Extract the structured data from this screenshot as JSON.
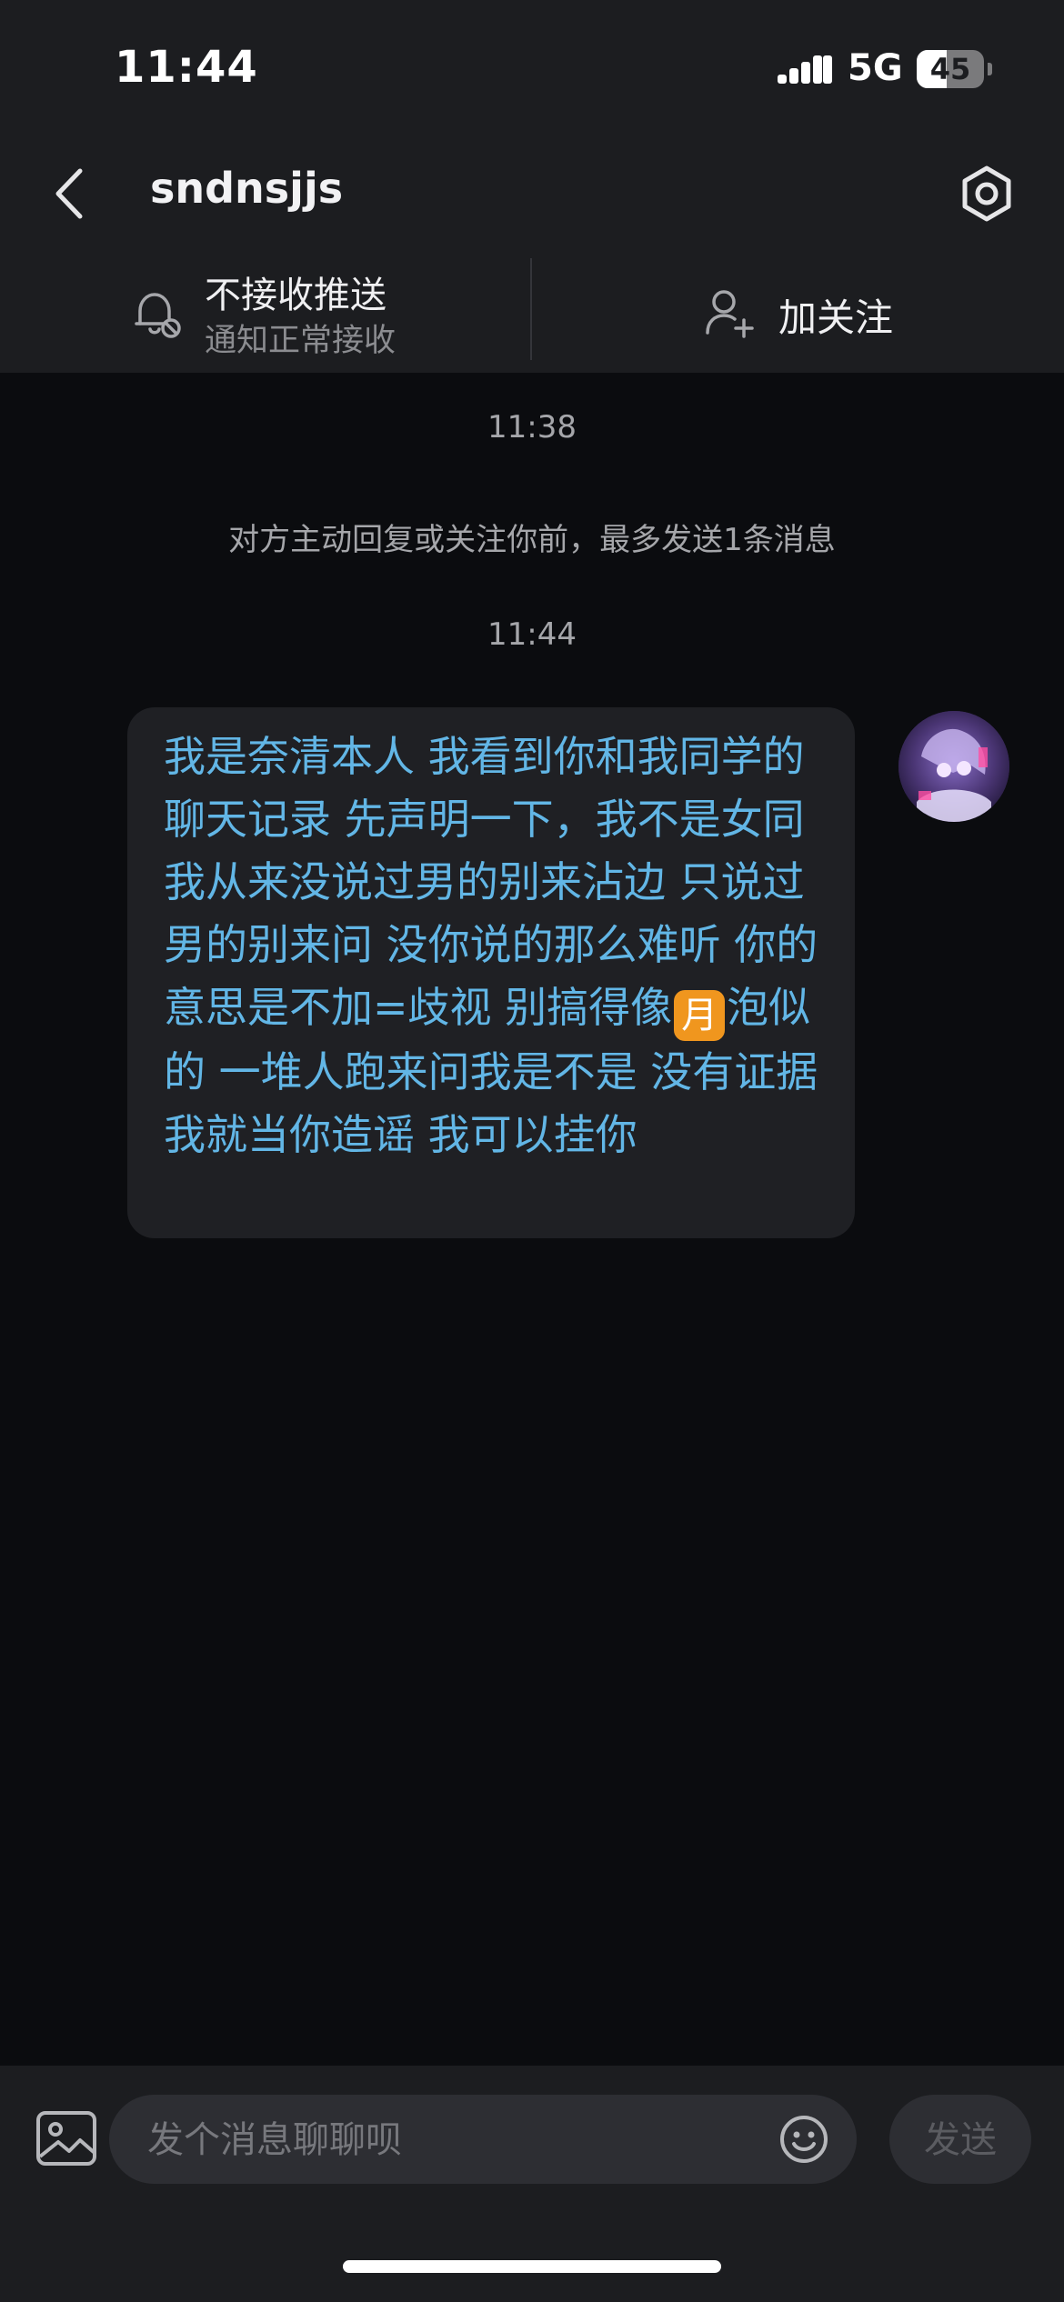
{
  "status_bar": {
    "time": "11:44",
    "network": "5G",
    "battery": "45",
    "battery_level": 0.45
  },
  "header": {
    "title": "sndnsjjs"
  },
  "action_bar": {
    "push_title": "不接收推送",
    "push_subtitle": "通知正常接收",
    "follow_label": "加关注"
  },
  "chat": {
    "timestamp_1": "11:38",
    "system_note": "对方主动回复或关注你前，最多发送1条消息",
    "timestamp_2": "11:44",
    "message_before_emoji": "我是奈清本人 我看到你和我同学的聊天记录 先声明一下，我不是女同 我从来没说过男的别来沾边 只说过男的别来问 没你说的那么难听 你的意思是不加=歧视 别搞得像",
    "emoji_glyph": "月",
    "message_after_emoji": "泡似的 一堆人跑来问我是不是 没有证据我就当你造谣 我可以挂你"
  },
  "input_bar": {
    "placeholder": "发个消息聊聊呗",
    "value": "",
    "send_label": "发送"
  },
  "icons": {
    "back": "chevron-left-icon",
    "settings": "hexagon-settings-icon",
    "bell": "bell-off-icon",
    "follow": "user-plus-icon",
    "image": "image-icon",
    "emoji": "smiley-icon"
  },
  "colors": {
    "message_text": "#62b6e6",
    "bubble_bg": "#1f2024",
    "chat_bg": "#0b0c0f",
    "header_bg": "#1c1d20",
    "emoji_bg": "#f0961e"
  }
}
